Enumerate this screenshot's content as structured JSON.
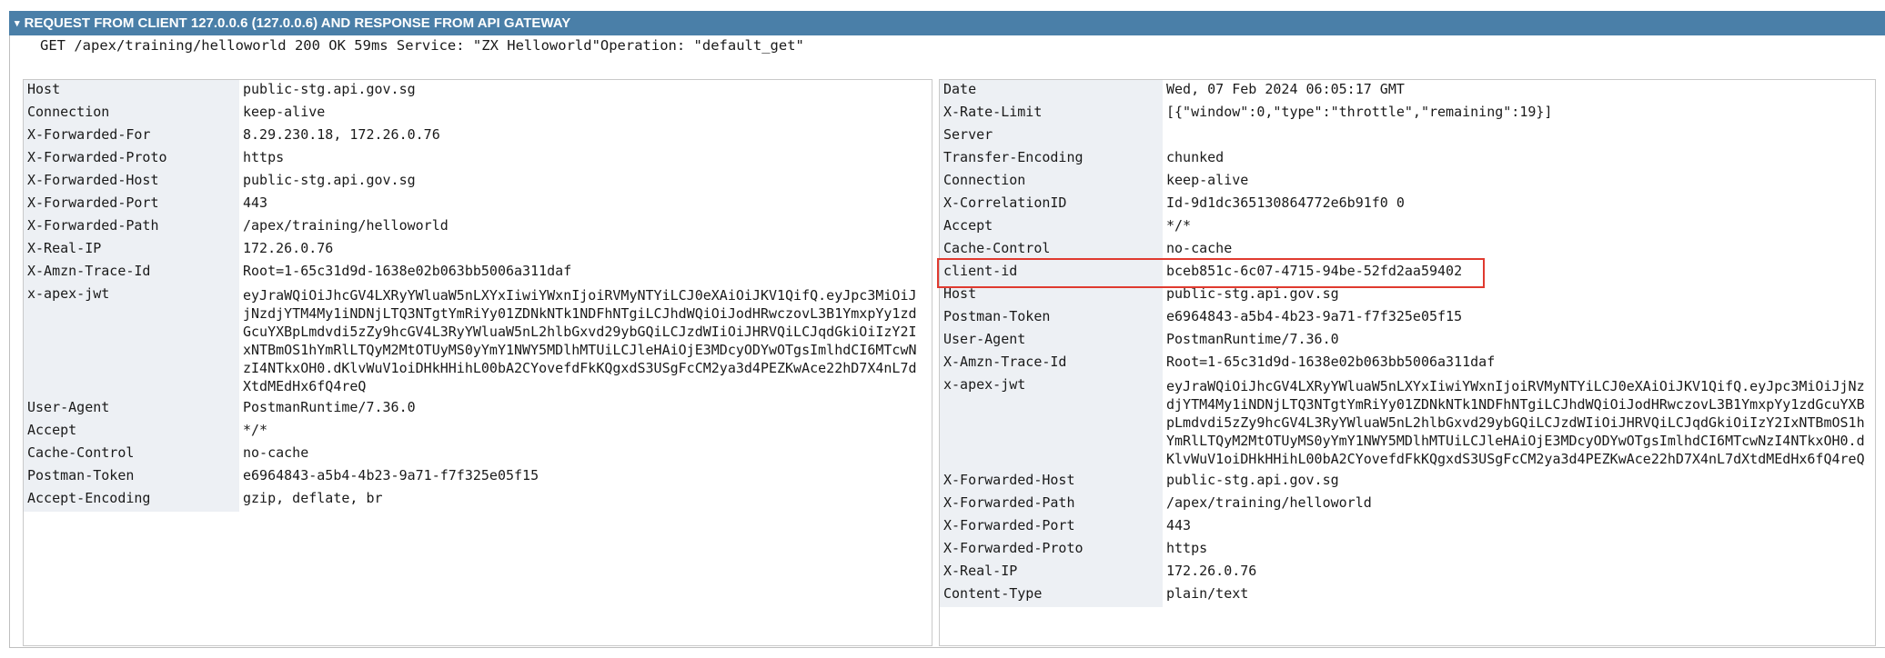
{
  "header": {
    "title": "REQUEST FROM CLIENT 127.0.0.6 (127.0.0.6) AND RESPONSE FROM API GATEWAY",
    "collapse_glyph": "▾"
  },
  "summary": "GET /apex/training/helloworld 200 OK 59ms Service: \"ZX Helloworld\"Operation: \"default_get\"",
  "request_headers": [
    {
      "key": "Host",
      "value": "public-stg.api.gov.sg"
    },
    {
      "key": "Connection",
      "value": "keep-alive"
    },
    {
      "key": "X-Forwarded-For",
      "value": "8.29.230.18, 172.26.0.76"
    },
    {
      "key": "X-Forwarded-Proto",
      "value": "https"
    },
    {
      "key": "X-Forwarded-Host",
      "value": "public-stg.api.gov.sg"
    },
    {
      "key": "X-Forwarded-Port",
      "value": "443"
    },
    {
      "key": "X-Forwarded-Path",
      "value": "/apex/training/helloworld"
    },
    {
      "key": "X-Real-IP",
      "value": "172.26.0.76"
    },
    {
      "key": "X-Amzn-Trace-Id",
      "value": "Root=1-65c31d9d-1638e02b063bb5006a311daf"
    },
    {
      "key": "x-apex-jwt",
      "value": "eyJraWQiOiJhcGV4LXRyYWluaW5nLXYxIiwiYWxnIjoiRVMyNTYiLCJ0eXAiOiJKV1QifQ.eyJpc3MiOiJjNzdjYTM4My1iNDNjLTQ3NTgtYmRiYy01ZDNkNTk1NDFhNTgiLCJhdWQiOiJodHRwczovL3B1YmxpYy1zdGcuYXBpLmdvdi5zZy9hcGV4L3RyYWluaW5nL2hlbGxvd29ybGQiLCJzdWIiOiJHRVQiLCJqdGkiOiIzY2IxNTBmOS1hYmRlLTQyM2MtOTUyMS0yYmY1NWY5MDlhMTUiLCJleHAiOjE3MDcyODYwOTgsImlhdCI6MTcwNzI4NTkxOH0.dKlvWuV1oiDHkHHihL00bA2CYovefdFkKQgxdS3USgFcCM2ya3d4PEZKwAce22hD7X4nL7dXtdMEdHx6fQ4reQ"
    },
    {
      "key": "User-Agent",
      "value": "PostmanRuntime/7.36.0"
    },
    {
      "key": "Accept",
      "value": "*/*"
    },
    {
      "key": "Cache-Control",
      "value": "no-cache"
    },
    {
      "key": "Postman-Token",
      "value": "e6964843-a5b4-4b23-9a71-f7f325e05f15"
    },
    {
      "key": "Accept-Encoding",
      "value": "gzip, deflate, br"
    }
  ],
  "response_headers": [
    {
      "key": "Date",
      "value": "Wed, 07 Feb 2024 06:05:17 GMT"
    },
    {
      "key": "X-Rate-Limit",
      "value": "[{\"window\":0,\"type\":\"throttle\",\"remaining\":19}]"
    },
    {
      "key": "Server",
      "value": ""
    },
    {
      "key": "Transfer-Encoding",
      "value": "chunked"
    },
    {
      "key": "Connection",
      "value": "keep-alive"
    },
    {
      "key": "X-CorrelationID",
      "value": "Id-9d1dc365130864772e6b91f0 0"
    },
    {
      "key": "Accept",
      "value": "*/*"
    },
    {
      "key": "Cache-Control",
      "value": "no-cache"
    },
    {
      "key": "client-id",
      "value": "bceb851c-6c07-4715-94be-52fd2aa59402"
    },
    {
      "key": "Host",
      "value": "public-stg.api.gov.sg"
    },
    {
      "key": "Postman-Token",
      "value": "e6964843-a5b4-4b23-9a71-f7f325e05f15"
    },
    {
      "key": "User-Agent",
      "value": "PostmanRuntime/7.36.0"
    },
    {
      "key": "X-Amzn-Trace-Id",
      "value": "Root=1-65c31d9d-1638e02b063bb5006a311daf"
    },
    {
      "key": "x-apex-jwt",
      "value": "eyJraWQiOiJhcGV4LXRyYWluaW5nLXYxIiwiYWxnIjoiRVMyNTYiLCJ0eXAiOiJKV1QifQ.eyJpc3MiOiJjNzdjYTM4My1iNDNjLTQ3NTgtYmRiYy01ZDNkNTk1NDFhNTgiLCJhdWQiOiJodHRwczovL3B1YmxpYy1zdGcuYXBpLmdvdi5zZy9hcGV4L3RyYWluaW5nL2hlbGxvd29ybGQiLCJzdWIiOiJHRVQiLCJqdGkiOiIzY2IxNTBmOS1hYmRlLTQyM2MtOTUyMS0yYmY1NWY5MDlhMTUiLCJleHAiOjE3MDcyODYwOTgsImlhdCI6MTcwNzI4NTkxOH0.dKlvWuV1oiDHkHHihL00bA2CYovefdFkKQgxdS3USgFcCM2ya3d4PEZKwAce22hD7X4nL7dXtdMEdHx6fQ4reQ"
    },
    {
      "key": "X-Forwarded-Host",
      "value": "public-stg.api.gov.sg"
    },
    {
      "key": "X-Forwarded-Path",
      "value": "/apex/training/helloworld"
    },
    {
      "key": "X-Forwarded-Port",
      "value": "443"
    },
    {
      "key": "X-Forwarded-Proto",
      "value": "https"
    },
    {
      "key": "X-Real-IP",
      "value": "172.26.0.76"
    },
    {
      "key": "Content-Type",
      "value": "plain/text"
    }
  ],
  "highlight_color": "#e03a2f",
  "header_color": "#4a7fa8",
  "key_cell_color": "#edf0f4"
}
